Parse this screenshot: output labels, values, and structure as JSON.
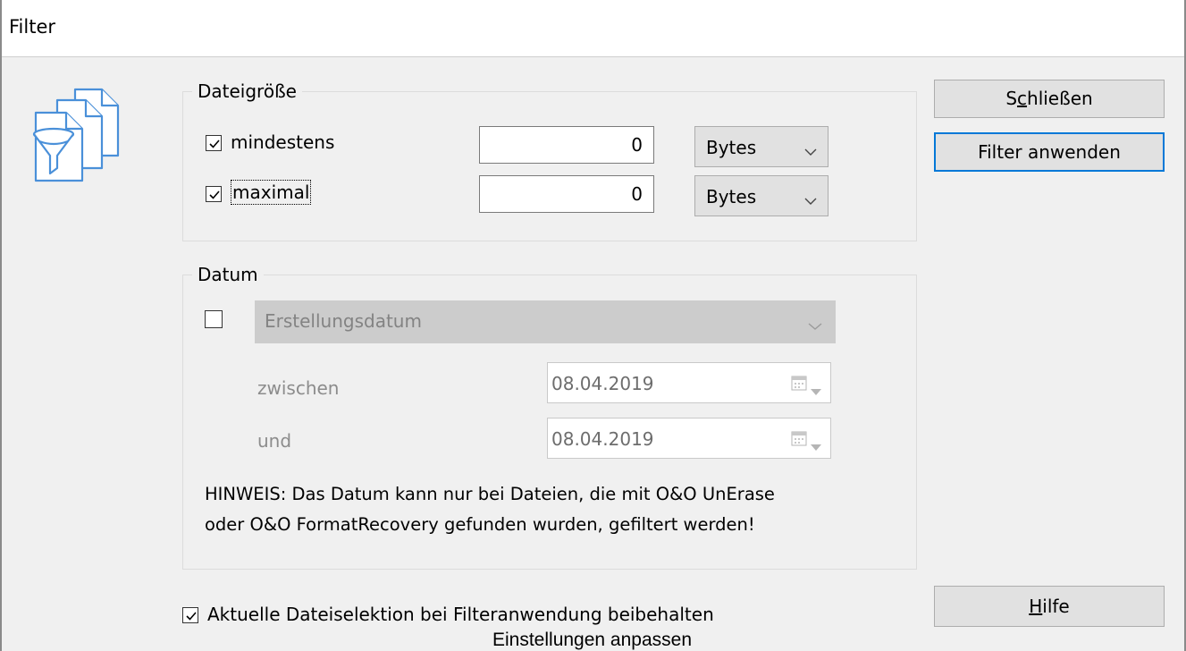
{
  "window": {
    "title": "Filter"
  },
  "icon": "file-filter-icon",
  "filesize": {
    "legend": "Dateigröße",
    "min": {
      "label": "mindestens",
      "checked": true,
      "value": "0",
      "unit": "Bytes"
    },
    "max": {
      "label": "maximal",
      "checked": true,
      "value": "0",
      "unit": "Bytes"
    }
  },
  "date": {
    "legend": "Datum",
    "enabled": false,
    "type": "Erstellungsdatum",
    "from_label": "zwischen",
    "from_value": "08.04.2019",
    "to_label": "und",
    "to_value": "08.04.2019",
    "note_line1": "HINWEIS: Das Datum kann nur bei Dateien, die mit O&O UnErase",
    "note_line2": "oder O&O FormatRecovery gefunden wurden, gefiltert werden!"
  },
  "keep_selection": {
    "label": "Aktuelle Dateiselektion bei Filteranwendung beibehalten",
    "checked": true
  },
  "buttons": {
    "close_pre": "S",
    "close_mnemonic": "c",
    "close_post": "hließen",
    "apply": "Filter anwenden",
    "help_mnemonic": "H",
    "help_post": "ilfe"
  },
  "footer": {
    "caption": "Einstellungen anpassen"
  },
  "colors": {
    "accent": "#0078d7",
    "icon": "#4a90d9",
    "disabled_text": "#8c8c8c"
  }
}
